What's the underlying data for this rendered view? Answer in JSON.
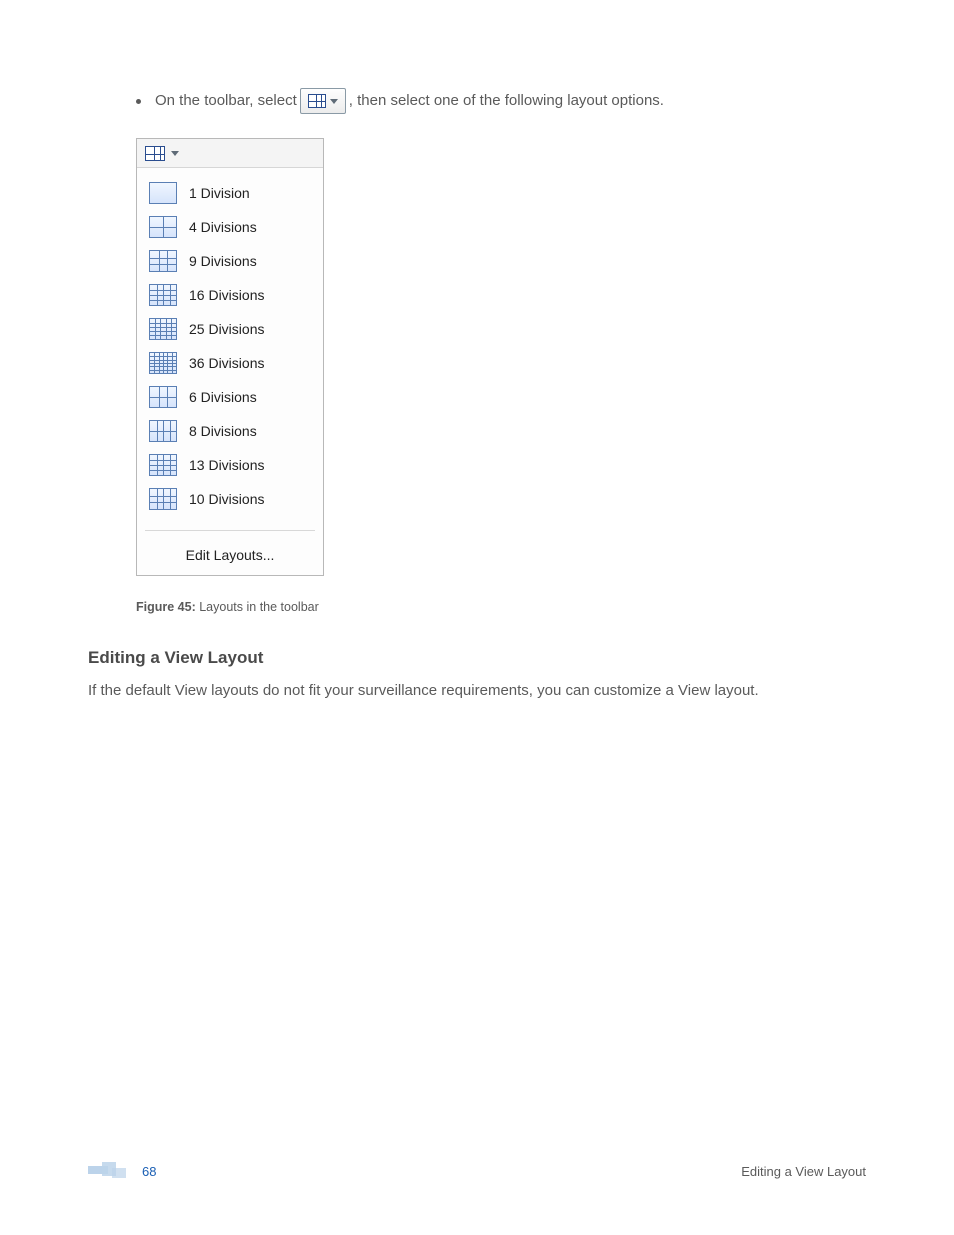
{
  "instruction": {
    "prefix": "On the toolbar, select",
    "suffix": ", then select one of the following layout options."
  },
  "layout_menu": {
    "items": [
      {
        "label": "1 Division",
        "grid": [
          1,
          1
        ]
      },
      {
        "label": "4 Divisions",
        "grid": [
          2,
          2
        ]
      },
      {
        "label": "9 Divisions",
        "grid": [
          3,
          3
        ]
      },
      {
        "label": "16 Divisions",
        "grid": [
          4,
          4
        ]
      },
      {
        "label": "25 Divisions",
        "grid": [
          5,
          5
        ]
      },
      {
        "label": "36 Divisions",
        "grid": [
          6,
          6
        ]
      },
      {
        "label": "6 Divisions",
        "grid": [
          3,
          2
        ]
      },
      {
        "label": "8 Divisions",
        "grid": [
          4,
          2
        ]
      },
      {
        "label": "13 Divisions",
        "grid": [
          4,
          4
        ]
      },
      {
        "label": "10 Divisions",
        "grid": [
          4,
          3
        ]
      }
    ],
    "edit_label": "Edit Layouts..."
  },
  "figure": {
    "label": "Figure 45:",
    "caption": "Layouts in the toolbar"
  },
  "section": {
    "heading": "Editing a View Layout",
    "body": "If the default View layouts do not fit your surveillance requirements, you can customize a View layout."
  },
  "footer": {
    "page": "68",
    "right": "Editing a View Layout"
  }
}
